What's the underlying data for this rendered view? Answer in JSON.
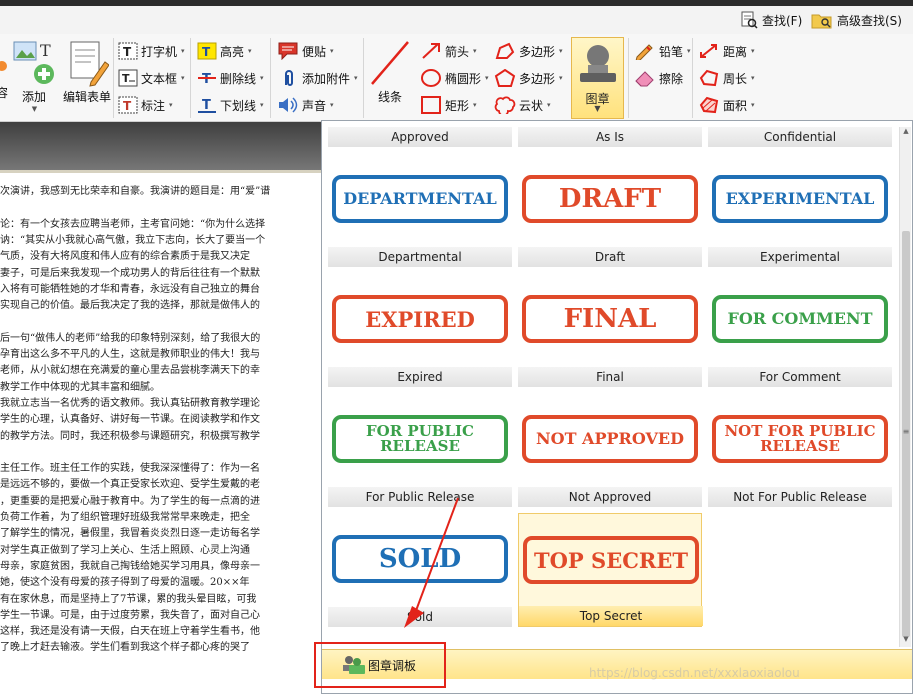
{
  "toolbar_top": {
    "find_label": "查找(F)",
    "advanced_find_label": "高级查找(S)"
  },
  "ribbon": {
    "partial_left_label": "容",
    "add_label": "添加",
    "edit_form_label": "编辑表单",
    "typewriter_label": "打字机",
    "textbox_label": "文本框",
    "callout_label": "标注",
    "highlight_label": "高亮",
    "strikeout_label": "删除线",
    "underline_label": "下划线",
    "note_label": "便贴",
    "attach_label": "添加附件",
    "sound_label": "声音",
    "line_label": "线条",
    "arrow_label": "箭头",
    "ellipse_label": "椭圆形",
    "rectangle_label": "矩形",
    "polygon_label": "多边形",
    "polyline_label": "多边形",
    "cloud_label": "云状",
    "stamp_label": "图章",
    "pencil_label": "铅笔",
    "eraser_label": "擦除",
    "distance_label": "距离",
    "perimeter_label": "周长",
    "area_label": "面积"
  },
  "document_lines": [
    "次演讲，我感到无比荣幸和自豪。我演讲的题目是：用“爱”谱",
    "",
    "论：有一个女孩去应聘当老师，主考官问她：“你为什么选择",
    "讷：“其实从小我就心高气傲，我立下志向，长大了要当一个",
    "气质，没有大将风度和伟人应有的综合素质于是我又决定",
    "妻子，可是后来我发现一个成功男人的背后往往有一个默默",
    "入将有可能牺牲她的才华和青春，永远没有自己独立的舞台",
    "实现自己的价值。最后我决定了我的选择，那就是做伟人的",
    "",
    "后一句“做伟人的老师”给我的印象特别深刻，给了我很大的",
    "孕育出这么多不平凡的人生，这就是教师职业的伟大！我与",
    "老师，从小就幻想在充满爱的童心里去品尝桃李满天下的幸",
    "教学工作中体现的尤其丰富和细腻。",
    "我就立志当一名优秀的语文教师。我认真钻研教育教学理论",
    "学生的心理，认真备好、讲好每一节课。在阅读教学和作文",
    "的教学方法。同时，我还积极参与课题研究，积极撰写教学",
    "",
    "主任工作。班主任工作的实践，使我深深懂得了：作为一名",
    "是远远不够的，要做一个真正受家长欢迎、受学生爱戴的老",
    "，更重要的是把爱心融于教育中。为了学生的每一点滴的进",
    "负荷工作着，为了组织管理好班级我常常早来晚走，把全",
    "了解学生的情况，暑假里，我冒着炎炎烈日逐一走访每名学",
    "对学生真正做到了学习上关心、生活上照顾、心灵上沟通",
    "母亲，家庭贫困，我就自己掏钱给她买学习用具，像母亲一",
    "她，使这个没有母爱的孩子得到了母爱的温暖。20××年",
    "有在家休息，而是坚持上了7节课，累的我头晕目眩，可我",
    "学生一节课。可是，由于过度劳累，我失音了，面对自己心",
    "这样，我还是没有请一天假，白天在班上守着学生看书，他",
    "了晚上才赶去输液。学生们看到我这个样子都心疼的哭了"
  ],
  "stamp_gallery": {
    "top_row_captions": [
      "Approved",
      "As Is",
      "Confidential"
    ],
    "stamps": [
      {
        "caption": "Departmental",
        "text": "DEPARTMENTAL",
        "color": "#1f6fb5",
        "selected": false
      },
      {
        "caption": "Draft",
        "text": "DRAFT",
        "color": "#e04a2a",
        "selected": false
      },
      {
        "caption": "Experimental",
        "text": "EXPERIMENTAL",
        "color": "#1f6fb5",
        "selected": false
      },
      {
        "caption": "Expired",
        "text": "EXPIRED",
        "color": "#e04a2a",
        "selected": false
      },
      {
        "caption": "Final",
        "text": "FINAL",
        "color": "#e04a2a",
        "selected": false
      },
      {
        "caption": "For Comment",
        "text": "FOR COMMENT",
        "color": "#3aa04a",
        "selected": false
      },
      {
        "caption": "For Public Release",
        "text": "FOR PUBLIC RELEASE",
        "color": "#3aa04a",
        "selected": false
      },
      {
        "caption": "Not Approved",
        "text": "NOT APPROVED",
        "color": "#e04a2a",
        "selected": false
      },
      {
        "caption": "Not For Public Release",
        "text": "NOT FOR PUBLIC RELEASE",
        "color": "#e04a2a",
        "selected": false
      },
      {
        "caption": "Sold",
        "text": "SOLD",
        "color": "#1f6fb5",
        "selected": false
      },
      {
        "caption": "Top Secret",
        "text": "TOP SECRET",
        "color": "#e04a2a",
        "selected": true
      }
    ],
    "footer_label": "图章调板"
  },
  "watermark": "https://blog.csdn.net/xxxlaoxiaolou",
  "colors": {
    "annotation_red": "#e2231a",
    "selected_fill": "#fff8dc",
    "footer_fill": "#ffe48a"
  }
}
